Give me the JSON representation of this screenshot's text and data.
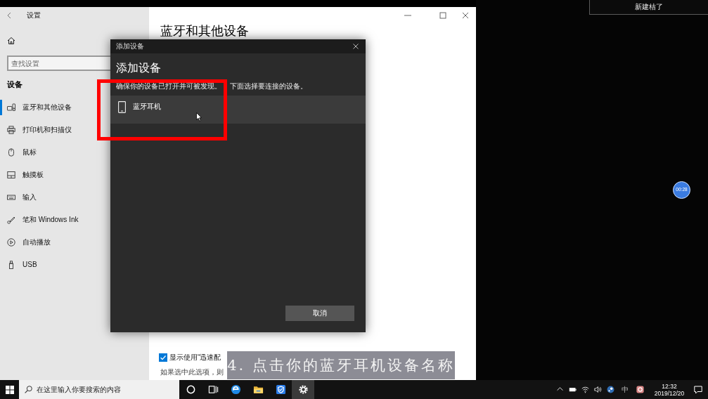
{
  "settings": {
    "title": "设置",
    "search": {
      "placeholder": "查找设置"
    },
    "section_title": "设备",
    "nav_items": [
      {
        "label": "蓝牙和其他设备",
        "selected": true
      },
      {
        "label": "打印机和扫描仪",
        "selected": false
      },
      {
        "label": "鼠标",
        "selected": false
      },
      {
        "label": "触摸板",
        "selected": false
      },
      {
        "label": "输入",
        "selected": false
      },
      {
        "label": "笔和 Windows Ink",
        "selected": false
      },
      {
        "label": "自动播放",
        "selected": false
      },
      {
        "label": "USB",
        "selected": false
      }
    ],
    "page_title": "蓝牙和其他设备",
    "quick_pair": {
      "label": "显示使用“迅速配",
      "checked": true
    },
    "note": "如果选中此选项，则"
  },
  "dialog": {
    "title": "添加设备",
    "heading": "添加设备",
    "description_parts": [
      "确保你的设备已打开并可被发现。",
      "下面选择要连接的设备。"
    ],
    "devices": [
      {
        "name": "蓝牙耳机",
        "hovered": true
      }
    ],
    "cancel_button": "取消"
  },
  "caption": "4. 点击你的蓝牙耳机设备名称",
  "desktop": {
    "notification": "新建桔了",
    "timer": "00:28"
  },
  "taskbar": {
    "search_placeholder": "在这里输入你要搜索的内容",
    "buttons": [
      {
        "active": false
      },
      {
        "active": false
      },
      {
        "active": false
      },
      {
        "active": false
      },
      {
        "active": false
      },
      {
        "active": true
      }
    ],
    "ime": "中",
    "time": "12:32",
    "date": "2019/12/20"
  }
}
